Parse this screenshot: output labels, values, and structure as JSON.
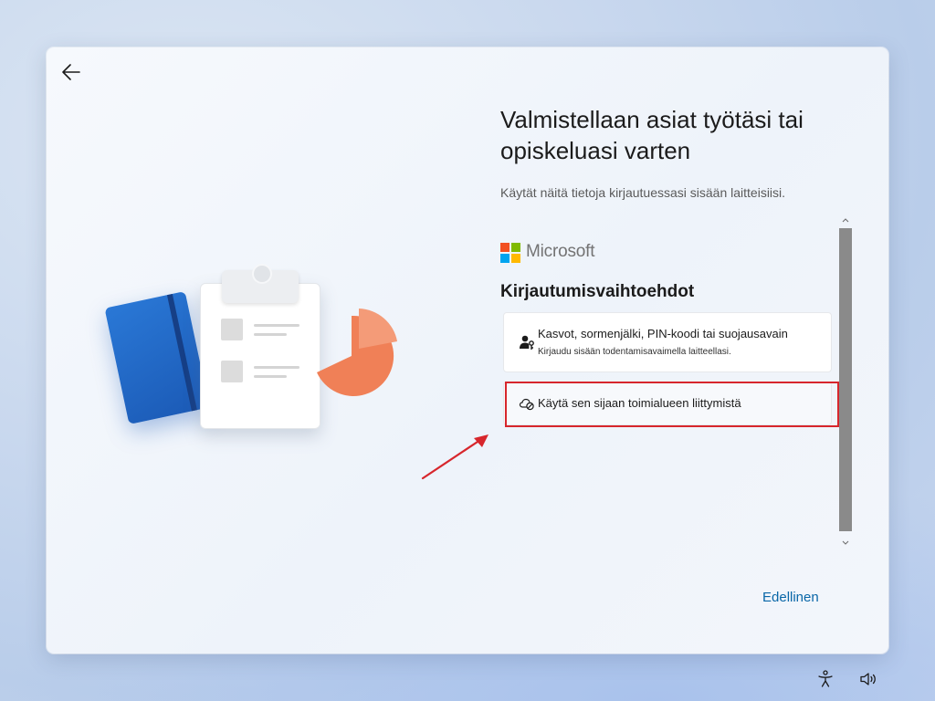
{
  "window": {
    "title": "Valmistellaan asiat työtäsi tai opiskeluasi varten",
    "subtitle": "Käytät näitä tietoja kirjautuessasi sisään laitteisiisi."
  },
  "brand": {
    "name": "Microsoft",
    "logo_colors": [
      "#f25022",
      "#7fba00",
      "#00a4ef",
      "#ffb900"
    ]
  },
  "signin": {
    "heading": "Kirjautumisvaihtoehdot",
    "options": [
      {
        "icon": "person-key-icon",
        "title": "Kasvot, sormenjälki, PIN-koodi tai suojausavain",
        "description": "Kirjaudu sisään todentamisavaimella laitteellasi."
      },
      {
        "icon": "cloud-blocked-icon",
        "title": "Käytä sen sijaan toimialueen liittymistä",
        "description": ""
      }
    ]
  },
  "navigation": {
    "back_icon": "back-arrow-icon",
    "previous_label": "Edellinen"
  },
  "annotation": {
    "highlight_color": "#d7262c"
  },
  "taskbar": {
    "icons": [
      "accessibility-icon",
      "volume-icon"
    ]
  },
  "colors": {
    "accent_link": "#0a67a8",
    "scroll_thumb": "#8a8a8a"
  }
}
